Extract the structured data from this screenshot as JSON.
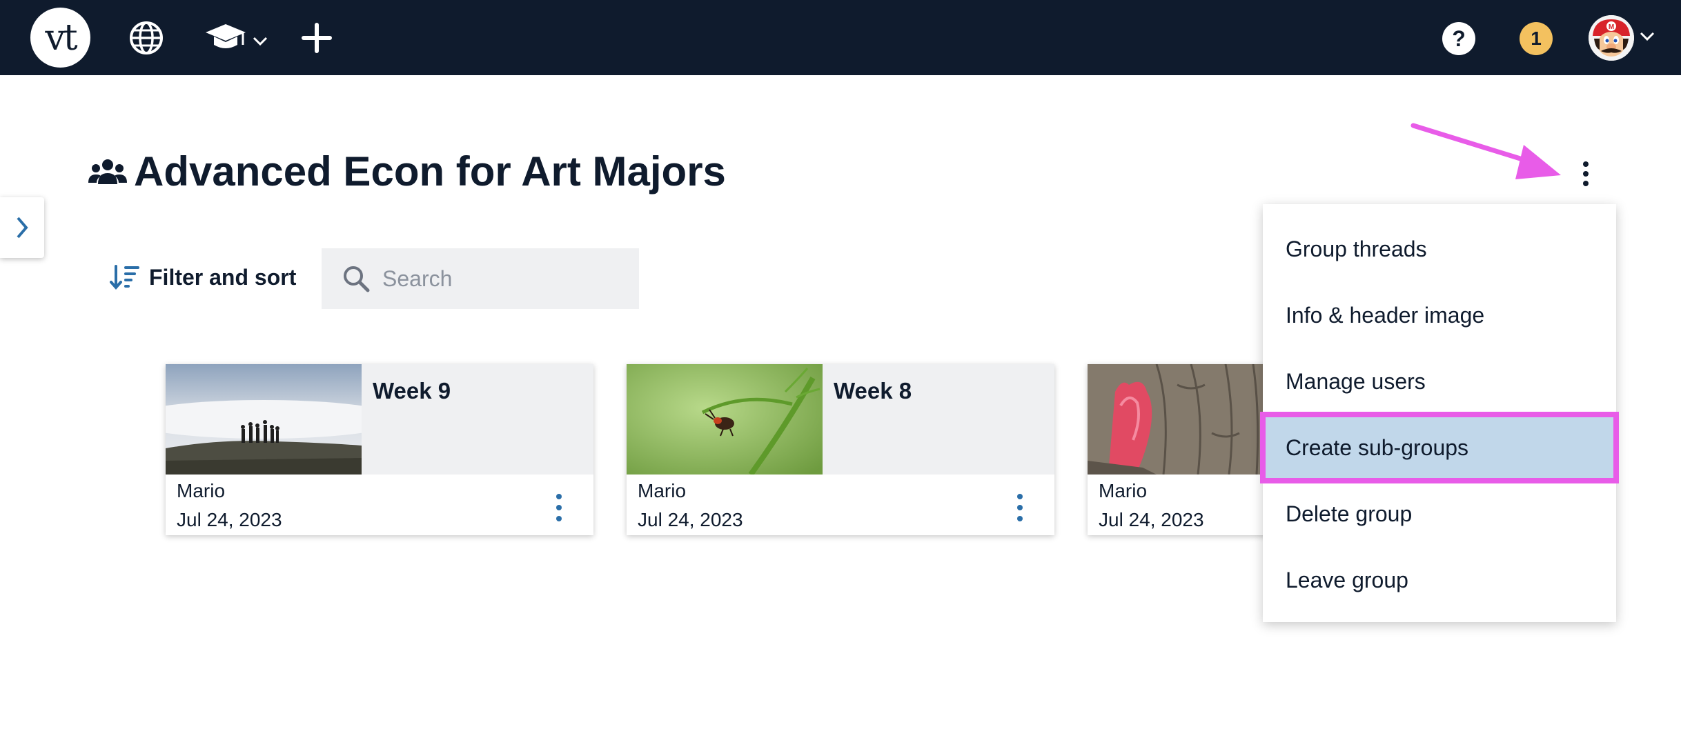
{
  "nav": {
    "logo_text": "vt",
    "notifications_count": "1",
    "help_label": "?"
  },
  "page": {
    "title": "Advanced Econ for Art Majors"
  },
  "toolbar": {
    "filter_label": "Filter and sort",
    "search_placeholder": "Search"
  },
  "cards": [
    {
      "title": "Week 9",
      "author": "Mario",
      "date": "Jul 24, 2023",
      "image": "fog-hikers-photo"
    },
    {
      "title": "Week 8",
      "author": "Mario",
      "date": "Jul 24, 2023",
      "image": "beetle-on-plant-photo"
    },
    {
      "title": "",
      "author": "Mario",
      "date": "Jul 24, 2023",
      "image": "red-flower-on-bark-photo"
    }
  ],
  "menu": {
    "items": [
      {
        "label": "Group threads"
      },
      {
        "label": "Info & header image"
      },
      {
        "label": "Manage users"
      },
      {
        "label": "Create sub-groups",
        "highlighted": true
      },
      {
        "label": "Delete group"
      },
      {
        "label": "Leave group"
      }
    ]
  },
  "colors": {
    "nav_bg": "#0f1b2d",
    "accent_blue": "#2a6ea8",
    "highlight_bg": "#c1d7ea",
    "annotation_magenta": "#e85ce8",
    "notif_badge": "#f3c15f"
  }
}
